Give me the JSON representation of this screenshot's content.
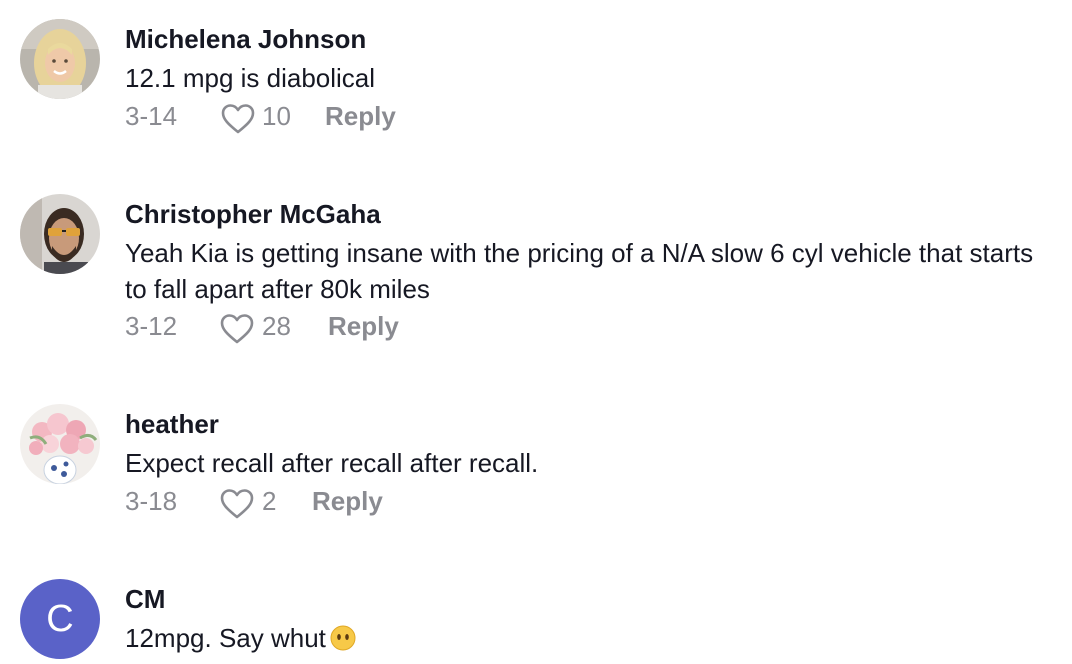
{
  "comments": [
    {
      "name": "Michelena Johnson",
      "text": "12.1 mpg is diabolical",
      "date": "3-14",
      "likes": "10",
      "reply": "Reply"
    },
    {
      "name": "Christopher McGaha",
      "text": "Yeah Kia is getting insane with the pricing of a N/A slow 6 cyl vehicle that starts to fall apart after 80k miles",
      "date": "3-12",
      "likes": "28",
      "reply": "Reply"
    },
    {
      "name": "heather",
      "text": "Expect recall after recall after recall.",
      "date": "3-18",
      "likes": "2",
      "reply": "Reply"
    },
    {
      "name": "CM",
      "avatar_letter": "C",
      "text": "12mpg. Say whut",
      "emoji": "face-without-mouth-icon"
    }
  ],
  "colors": {
    "text_primary": "#161823",
    "text_secondary": "#8a8b91",
    "letter_avatar_bg": "#5a62c8"
  }
}
